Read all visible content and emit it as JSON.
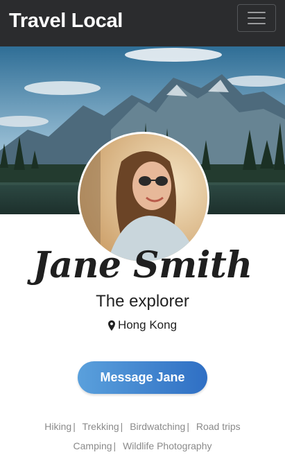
{
  "navbar": {
    "brand": "Travel Local",
    "menu_icon": "hamburger-icon"
  },
  "profile": {
    "name": "Jane Smith",
    "tagline": "The explorer",
    "location": "Hong Kong",
    "location_icon": "map-pin-icon",
    "message_button": "Message Jane"
  },
  "interests": [
    "Hiking",
    "Trekking",
    "Birdwatching",
    "Road trips",
    "Camping",
    "Wildlife Photography"
  ],
  "interest_separator": "|",
  "colors": {
    "navbar": "#2b2c2e",
    "button_start": "#5aa0dc",
    "button_end": "#2f6fc4",
    "tag_text": "#8a8a8a"
  }
}
